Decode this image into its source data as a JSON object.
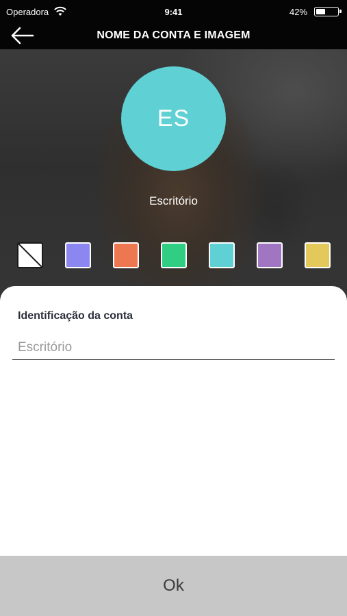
{
  "status_bar": {
    "carrier": "Operadora",
    "time": "9:41",
    "battery_percent": "42%",
    "battery_level": 0.42
  },
  "nav": {
    "back_icon": "arrow-left-icon",
    "title": "NOME DA CONTA E IMAGEM"
  },
  "avatar": {
    "initials": "ES",
    "color": "#5fd0d4"
  },
  "account_name": "Escritório",
  "swatches": [
    {
      "name": "none",
      "color": "#ffffff"
    },
    {
      "name": "periwinkle",
      "color": "#8c86f0"
    },
    {
      "name": "orange",
      "color": "#ec7751"
    },
    {
      "name": "green",
      "color": "#2fce83"
    },
    {
      "name": "cyan",
      "color": "#5fd0d4"
    },
    {
      "name": "purple",
      "color": "#a076c2"
    },
    {
      "name": "yellow",
      "color": "#e3c85b"
    }
  ],
  "form": {
    "label": "Identificação da conta",
    "placeholder": "Escritório",
    "value": ""
  },
  "ok_label": "Ok"
}
